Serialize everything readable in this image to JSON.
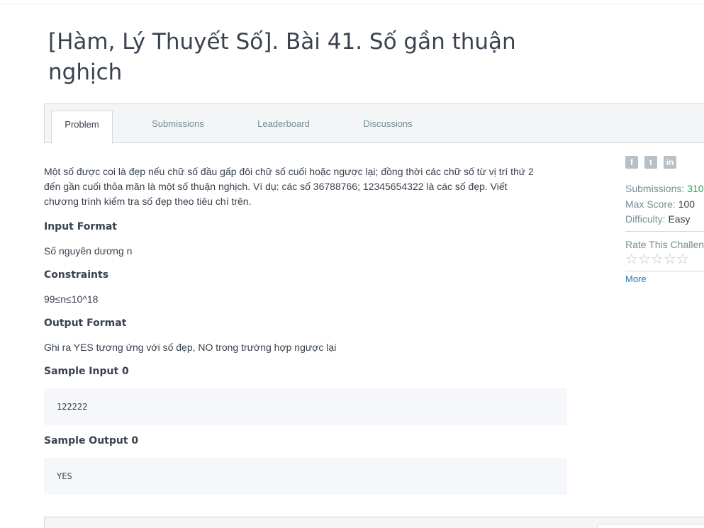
{
  "page": {
    "title_line1": "[Hàm, Lý Thuyết Số]. Bài 41. Số gần thuận",
    "title_line2": "nghịch"
  },
  "tabs": [
    {
      "label": "Problem",
      "active": true
    },
    {
      "label": "Submissions",
      "active": false
    },
    {
      "label": "Leaderboard",
      "active": false
    },
    {
      "label": "Discussions",
      "active": false
    }
  ],
  "problem": {
    "description": [
      "Một số được coi là đẹp nếu chữ số đầu gấp đôi chữ số cuối hoặc ngược lại; đồng thời các chữ số từ vị trí thứ 2",
      "đến gần cuối thỏa mãn là một số thuận nghịch. Ví dụ: các số 36788766; 12345654322 là các số đẹp. Viết",
      "chương trình kiểm tra số đẹp theo tiêu chí trên."
    ],
    "input_format_heading": "Input Format",
    "input_format_text": "Số nguyên dương n",
    "constraints_heading": "Constraints",
    "constraints_text": "99≤n≤10^18",
    "output_format_heading": "Output Format",
    "output_format_text": "Ghi ra YES tương ứng với số đẹp, NO trong trường hợp ngược lại",
    "sample_input_heading": "Sample Input 0",
    "sample_input_value": "122222",
    "sample_output_heading": "Sample Output 0",
    "sample_output_value": "YES"
  },
  "sidebar": {
    "share_icons": [
      "facebook-icon",
      "twitter-icon",
      "linkedin-icon"
    ],
    "submissions_label": "Submissions:",
    "submissions_value": "310",
    "max_score_label": "Max Score:",
    "max_score_value": "100",
    "difficulty_label": "Difficulty:",
    "difficulty_value": "Easy",
    "rate_title": "Rate This Challenge:",
    "rating_stars": 5,
    "more_label": "More"
  },
  "colors": {
    "accent_green": "#1ba94c",
    "link_blue": "#1c75bc",
    "muted": "#738f93",
    "text": "#39424e"
  }
}
